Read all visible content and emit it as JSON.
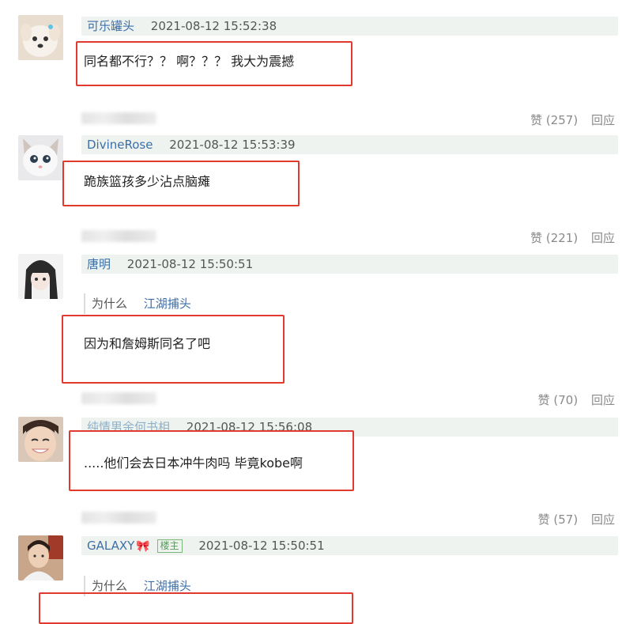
{
  "comments": [
    {
      "username": "可乐罐头",
      "time": "2021-08-12 15:52:38",
      "text": "同名都不行？？ 啊？？？ 我大为震撼",
      "likes": "赞 (257)",
      "reply": "回应",
      "avatar": "puppy"
    },
    {
      "username": "DivineRose",
      "time": "2021-08-12 15:53:39",
      "text": "跪族篮孩多少沾点脑瘫",
      "likes": "赞 (221)",
      "reply": "回应",
      "avatar": "kitten"
    },
    {
      "username": "唐明",
      "time": "2021-08-12 15:50:51",
      "quote_prefix": "为什么",
      "quote_name": "江湖捕头",
      "text": "因为和詹姆斯同名了吧",
      "likes": "赞 (70)",
      "reply": "回应",
      "avatar": "anime-girl"
    },
    {
      "username": "纯情男余何书相",
      "time": "2021-08-12 15:56:08",
      "text": ".....他们会去日本冲牛肉吗 毕竟kobe啊",
      "likes": "赞 (57)",
      "reply": "回应",
      "avatar": "smiling-man"
    },
    {
      "username": "GALAXY",
      "badge": "楼主",
      "time": "2021-08-12 15:50:51",
      "quote_prefix": "为什么",
      "quote_name": "江湖捕头",
      "avatar": "man-portrait"
    }
  ]
}
